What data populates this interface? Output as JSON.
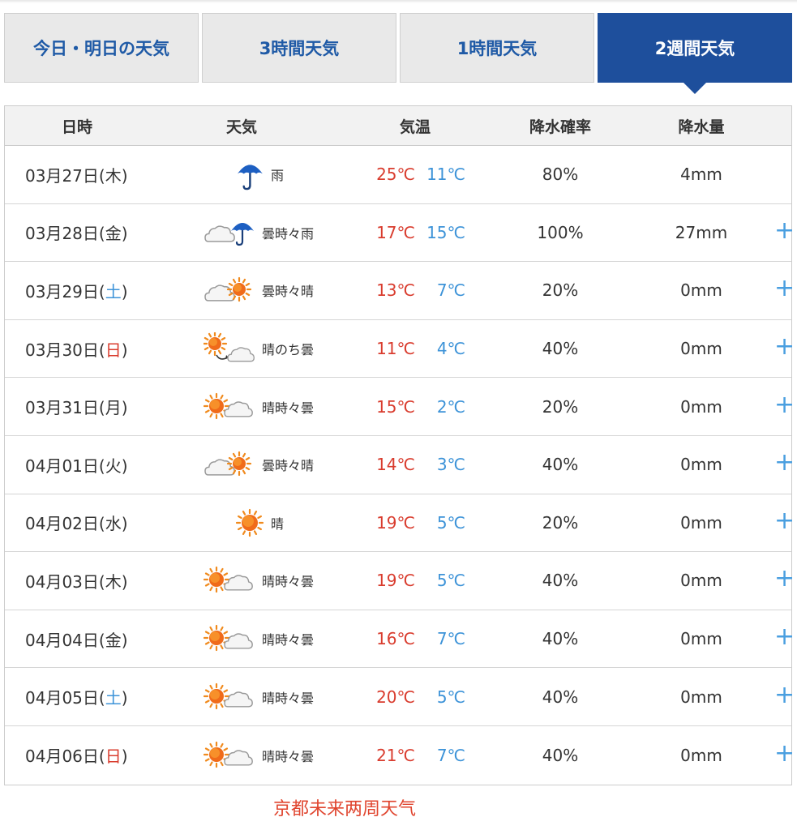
{
  "tabs": [
    {
      "label": "今日・明日の天気",
      "active": false
    },
    {
      "label": "3時間天気",
      "active": false
    },
    {
      "label": "1時間天気",
      "active": false
    },
    {
      "label": "2週間天気",
      "active": true
    }
  ],
  "table": {
    "headers": {
      "date": "日時",
      "weather": "天気",
      "temp": "気温",
      "precip_prob": "降水確率",
      "precip_amt": "降水量"
    },
    "expand_label": "+",
    "rows": [
      {
        "date": "03月27日(",
        "dow": "木",
        "dow_type": "weekday",
        "close": ")",
        "icon": "umbrella-icon",
        "weather": "雨",
        "hi": "25℃",
        "lo": "11℃",
        "prob": "80%",
        "amt": "4mm",
        "expandable": false
      },
      {
        "date": "03月28日(",
        "dow": "金",
        "dow_type": "weekday",
        "close": ")",
        "icon": "cloud-umbrella-icon",
        "weather": "曇時々雨",
        "hi": "17℃",
        "lo": "15℃",
        "prob": "100%",
        "amt": "27mm",
        "expandable": true
      },
      {
        "date": "03月29日(",
        "dow": "土",
        "dow_type": "saturday",
        "close": ")",
        "icon": "cloud-sun-icon",
        "weather": "曇時々晴",
        "hi": "13℃",
        "lo": "7℃",
        "prob": "20%",
        "amt": "0mm",
        "expandable": true
      },
      {
        "date": "03月30日(",
        "dow": "日",
        "dow_type": "sunday",
        "close": ")",
        "icon": "sun-then-cloud-icon",
        "weather": "晴のち曇",
        "hi": "11℃",
        "lo": "4℃",
        "prob": "40%",
        "amt": "0mm",
        "expandable": true
      },
      {
        "date": "03月31日(",
        "dow": "月",
        "dow_type": "weekday",
        "close": ")",
        "icon": "sun-cloud-icon",
        "weather": "晴時々曇",
        "hi": "15℃",
        "lo": "2℃",
        "prob": "20%",
        "amt": "0mm",
        "expandable": true
      },
      {
        "date": "04月01日(",
        "dow": "火",
        "dow_type": "weekday",
        "close": ")",
        "icon": "cloud-sun-icon",
        "weather": "曇時々晴",
        "hi": "14℃",
        "lo": "3℃",
        "prob": "40%",
        "amt": "0mm",
        "expandable": true
      },
      {
        "date": "04月02日(",
        "dow": "水",
        "dow_type": "weekday",
        "close": ")",
        "icon": "sun-icon",
        "weather": "晴",
        "hi": "19℃",
        "lo": "5℃",
        "prob": "20%",
        "amt": "0mm",
        "expandable": true
      },
      {
        "date": "04月03日(",
        "dow": "木",
        "dow_type": "weekday",
        "close": ")",
        "icon": "sun-cloud-icon",
        "weather": "晴時々曇",
        "hi": "19℃",
        "lo": "5℃",
        "prob": "40%",
        "amt": "0mm",
        "expandable": true
      },
      {
        "date": "04月04日(",
        "dow": "金",
        "dow_type": "weekday",
        "close": ")",
        "icon": "sun-cloud-icon",
        "weather": "晴時々曇",
        "hi": "16℃",
        "lo": "7℃",
        "prob": "40%",
        "amt": "0mm",
        "expandable": true
      },
      {
        "date": "04月05日(",
        "dow": "土",
        "dow_type": "saturday",
        "close": ")",
        "icon": "sun-cloud-icon",
        "weather": "晴時々曇",
        "hi": "20℃",
        "lo": "5℃",
        "prob": "40%",
        "amt": "0mm",
        "expandable": true
      },
      {
        "date": "04月06日(",
        "dow": "日",
        "dow_type": "sunday",
        "close": ")",
        "icon": "sun-cloud-icon",
        "weather": "晴時々曇",
        "hi": "21℃",
        "lo": "7℃",
        "prob": "40%",
        "amt": "0mm",
        "expandable": true
      }
    ]
  },
  "caption": "京都未来两周天气",
  "colors": {
    "active_tab": "#1e4f9c",
    "high_temp": "#d93c2e",
    "low_temp": "#3d93d8",
    "caption": "#e0452f"
  }
}
